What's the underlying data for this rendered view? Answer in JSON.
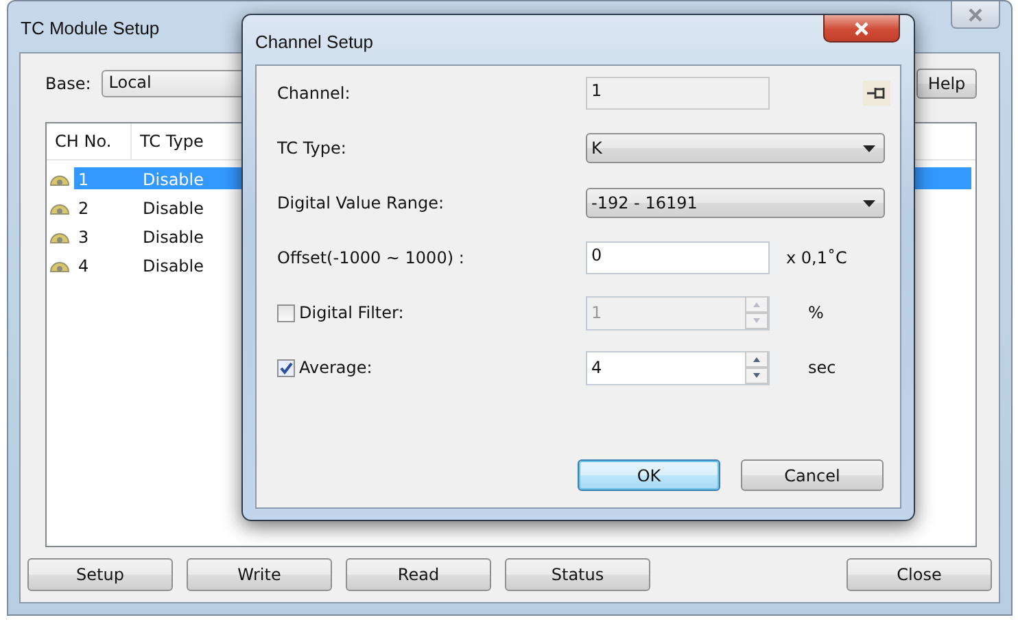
{
  "main_window": {
    "title": "TC Module Setup",
    "base": {
      "label": "Base:",
      "value": "Local"
    },
    "help_button": "Help",
    "table": {
      "columns": [
        "CH No.",
        "TC Type"
      ],
      "rows": [
        {
          "ch": "1",
          "tc_type": "Disable",
          "selected": true
        },
        {
          "ch": "2",
          "tc_type": "Disable",
          "selected": false
        },
        {
          "ch": "3",
          "tc_type": "Disable",
          "selected": false
        },
        {
          "ch": "4",
          "tc_type": "Disable",
          "selected": false
        }
      ]
    },
    "buttons": [
      "Setup",
      "Write",
      "Read",
      "Status",
      "Close"
    ]
  },
  "dialog": {
    "title": "Channel Setup",
    "fields": [
      {
        "kind": "readonly",
        "label": "Channel:",
        "value": "1"
      },
      {
        "kind": "dropdown",
        "label": "TC Type:",
        "value": "K"
      },
      {
        "kind": "dropdown",
        "label": "Digital Value Range:",
        "value": "-192 - 16191"
      },
      {
        "kind": "text",
        "label": "Offset(-1000 ~ 1000) :",
        "value": "0",
        "unit": "x 0,1˚C"
      },
      {
        "kind": "spin",
        "label": "Digital Filter:",
        "checked": false,
        "disabled": true,
        "value": "1",
        "unit": "%"
      },
      {
        "kind": "spin",
        "label": "Average:",
        "checked": true,
        "disabled": false,
        "value": "4",
        "unit": "sec"
      }
    ],
    "buttons": [
      {
        "label": "OK",
        "default": true
      },
      {
        "label": "Cancel",
        "default": false
      }
    ]
  }
}
